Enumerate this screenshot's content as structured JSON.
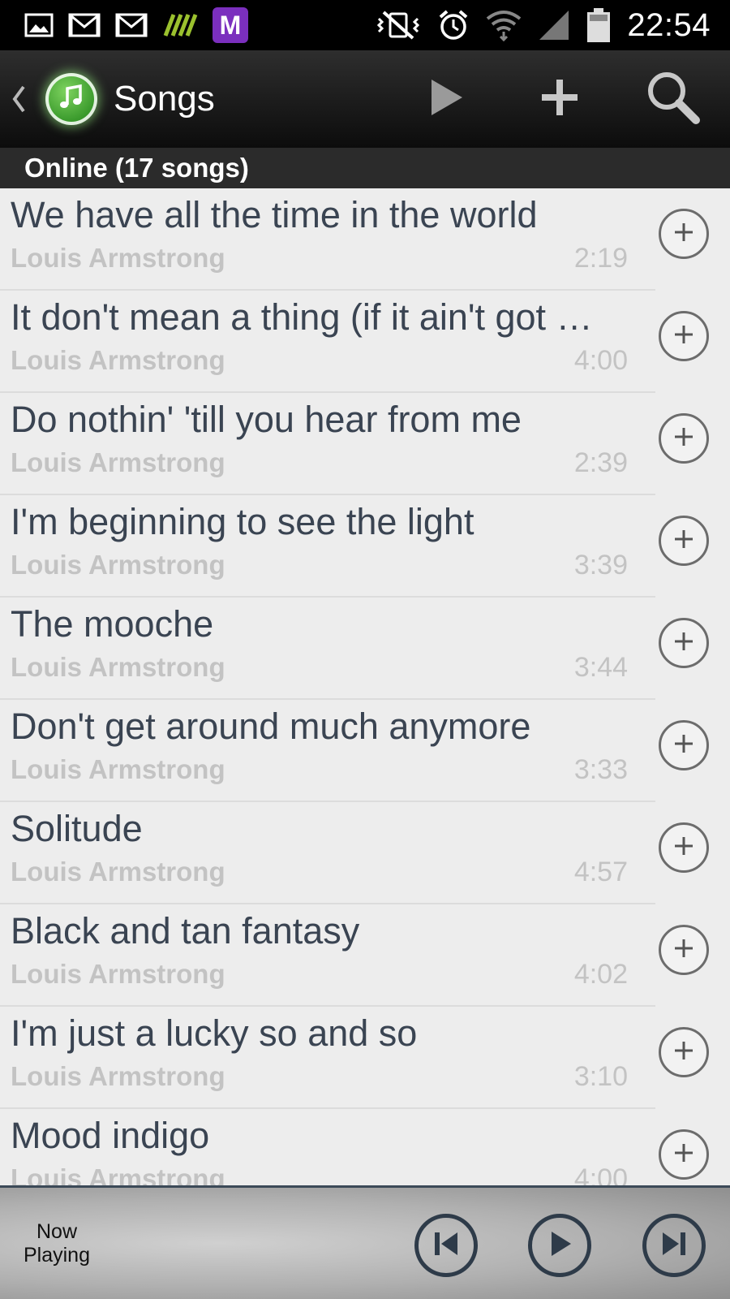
{
  "status_bar": {
    "time": "22:54",
    "left_icons": [
      "image-icon",
      "gmail-icon",
      "gmail-icon",
      "stripes-app-icon",
      "m-app-icon"
    ],
    "right_icons": [
      "vibrate-mute-icon",
      "alarm-icon",
      "wifi-icon",
      "signal-icon",
      "battery-icon"
    ],
    "m_app_letter": "M"
  },
  "action_bar": {
    "title": "Songs",
    "icons": [
      "back-chevron-icon",
      "music-note-icon",
      "play-icon",
      "add-icon",
      "search-icon"
    ]
  },
  "section": {
    "header": "Online (17 songs)"
  },
  "songs": [
    {
      "title": "We have all the time in the world",
      "artist": "Louis Armstrong",
      "duration": "2:19"
    },
    {
      "title": "It don't mean a thing (if it ain't got t…",
      "artist": "Louis Armstrong",
      "duration": "4:00"
    },
    {
      "title": "Do nothin' 'till you hear from me",
      "artist": "Louis Armstrong",
      "duration": "2:39"
    },
    {
      "title": "I'm beginning to see the light",
      "artist": "Louis Armstrong",
      "duration": "3:39"
    },
    {
      "title": "The mooche",
      "artist": "Louis Armstrong",
      "duration": "3:44"
    },
    {
      "title": "Don't get around much anymore",
      "artist": "Louis Armstrong",
      "duration": "3:33"
    },
    {
      "title": "Solitude",
      "artist": "Louis Armstrong",
      "duration": "4:57"
    },
    {
      "title": "Black and tan fantasy",
      "artist": "Louis Armstrong",
      "duration": "4:02"
    },
    {
      "title": "I'm just a lucky so and so",
      "artist": "Louis Armstrong",
      "duration": "3:10"
    },
    {
      "title": "Mood indigo",
      "artist": "Louis Armstrong",
      "duration": "4:00"
    }
  ],
  "player": {
    "now_playing_label": "Now Playing",
    "controls": [
      "skip-previous-icon",
      "play-icon",
      "skip-next-icon"
    ]
  },
  "colors": {
    "title_text": "#3a4452",
    "secondary_text": "#c3c3c3",
    "list_background": "#ededed",
    "header_background": "#2b2b2b",
    "control_stroke": "#2e3b49",
    "accent_green": "#3a9a2c",
    "m_app_purple": "#7b2fbe"
  }
}
